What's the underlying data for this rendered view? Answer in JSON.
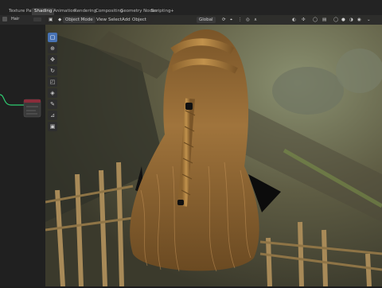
{
  "tabs": [
    {
      "label": "Texture Paint",
      "active": false
    },
    {
      "label": "Shading",
      "active": true
    },
    {
      "label": "Animation",
      "active": false
    },
    {
      "label": "Rendering",
      "active": false
    },
    {
      "label": "Compositing",
      "active": false
    },
    {
      "label": "Geometry Nodes",
      "active": false
    },
    {
      "label": "Scripting",
      "active": false
    },
    {
      "label": "+",
      "active": false
    }
  ],
  "left_header": {
    "object_name": "Hair"
  },
  "viewport_header": {
    "mode": "Object Mode",
    "menus": [
      "View",
      "Select",
      "Add",
      "Object"
    ],
    "transform_orientation": "Global"
  },
  "toolbar": [
    {
      "icon": "select-box-icon",
      "active": true
    },
    {
      "icon": "cursor-icon",
      "active": false
    },
    {
      "icon": "move-icon",
      "active": false
    },
    {
      "icon": "rotate-icon",
      "active": false
    },
    {
      "icon": "scale-icon",
      "active": false
    },
    {
      "icon": "transform-icon",
      "active": false
    },
    {
      "icon": "annotate-icon",
      "active": false
    },
    {
      "icon": "measure-icon",
      "active": false
    },
    {
      "icon": "add-cube-icon",
      "active": false
    }
  ],
  "colors": {
    "accent": "#4772b3",
    "node_wire": "#2ecc71"
  }
}
